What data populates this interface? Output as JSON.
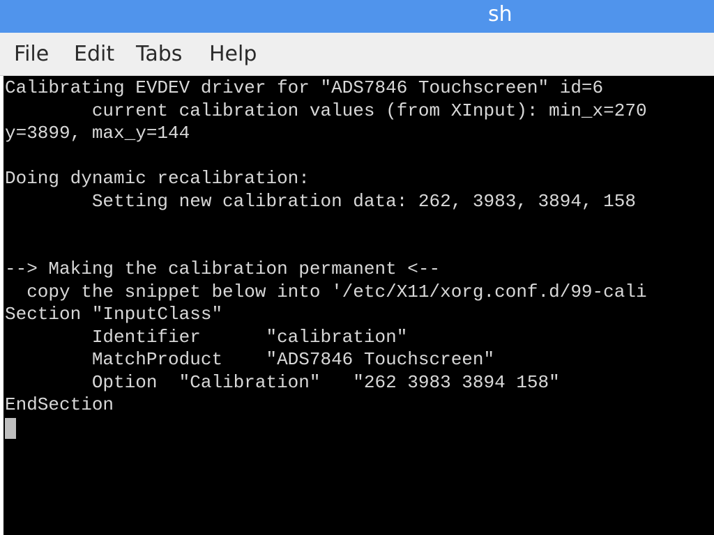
{
  "window": {
    "title": "sh"
  },
  "menu": {
    "items": [
      "File",
      "Edit",
      "Tabs",
      "Help"
    ]
  },
  "terminal": {
    "lines": [
      "Calibrating EVDEV driver for \"ADS7846 Touchscreen\" id=6",
      "        current calibration values (from XInput): min_x=270",
      "y=3899, max_y=144",
      "",
      "Doing dynamic recalibration:",
      "        Setting new calibration data: 262, 3983, 3894, 158",
      "",
      "",
      "--> Making the calibration permanent <--",
      "  copy the snippet below into '/etc/X11/xorg.conf.d/99-cali",
      "Section \"InputClass\"",
      "        Identifier      \"calibration\"",
      "        MatchProduct    \"ADS7846 Touchscreen\"",
      "        Option  \"Calibration\"   \"262 3983 3894 158\"",
      "EndSection"
    ]
  },
  "colors": {
    "titlebar": "#5094ec",
    "menubar": "#efefef",
    "terminal_bg": "#000000",
    "terminal_fg": "#d8d8d8"
  }
}
